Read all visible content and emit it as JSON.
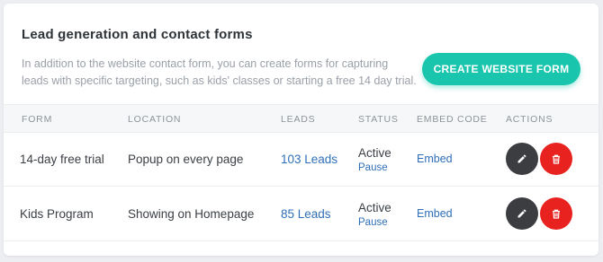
{
  "header": {
    "title": "Lead generation and contact forms",
    "description": "In addition to the website contact form, you can create forms for capturing leads with specific targeting, such as kids' classes or starting a free 14 day trial.",
    "cta_label": "CREATE WEBSITE FORM"
  },
  "table": {
    "columns": [
      "FORM",
      "LOCATION",
      "LEADS",
      "STATUS",
      "EMBED CODE",
      "ACTIONS"
    ],
    "rows": [
      {
        "form": "14-day free trial",
        "location": "Popup on every page",
        "leads": "103 Leads",
        "status": "Active",
        "status_action": "Pause",
        "embed": "Embed"
      },
      {
        "form": "Kids Program",
        "location": "Showing on Homepage",
        "leads": "85 Leads",
        "status": "Active",
        "status_action": "Pause",
        "embed": "Embed"
      }
    ]
  },
  "colors": {
    "accent": "#19c6ad",
    "link": "#2f6fb8",
    "edit_button": "#3b3d40",
    "delete_button": "#e8221e"
  },
  "icons": {
    "edit": "pencil-icon",
    "delete": "trash-icon"
  }
}
